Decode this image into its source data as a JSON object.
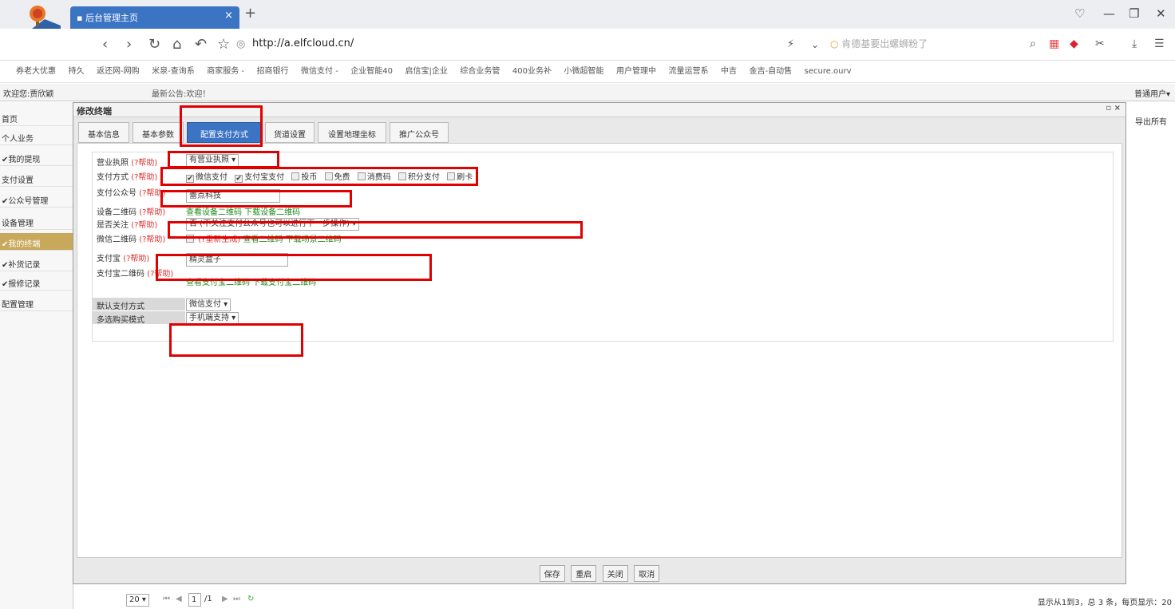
{
  "browser": {
    "tab_title": "后台管理主页",
    "tab_close": "×",
    "new_tab": "+",
    "url": "http://a.elfcloud.cn/",
    "search_placeholder": "肯德基要出螺蛳粉了"
  },
  "bookmarks": [
    "券老大优惠",
    "持久",
    "返还网-网购",
    "米泉-查询系",
    "商家服务 -",
    "招商银行",
    "微信支付 -",
    "企业智能40",
    "启信宝|企业",
    "综合业务管",
    "400业务补",
    "小微超智能",
    "用户管理中",
    "流量运营系",
    "中吉",
    "金吉-自动售",
    "secure.ourv"
  ],
  "appbar": {
    "welcome": "欢迎您:贾欣颖",
    "notice": "最新公告:欢迎！",
    "user_menu": "普通用户▾"
  },
  "sidebar": {
    "items": [
      {
        "label": "首页"
      },
      {
        "label": "个人业务"
      },
      {
        "label": "✔我的提现"
      },
      {
        "label": "支付设置"
      },
      {
        "label": "✔公众号管理"
      },
      {
        "label": "设备管理"
      },
      {
        "label": "✔我的终端"
      },
      {
        "label": "✔补货记录"
      },
      {
        "label": "✔报修记录"
      },
      {
        "label": "配置管理"
      }
    ]
  },
  "right_button": "导出所有",
  "dialog": {
    "title": "修改终端",
    "controls": "▫ ×",
    "tabs": [
      {
        "label": "基本信息"
      },
      {
        "label": "基本参数"
      },
      {
        "label": "配置支付方式"
      },
      {
        "label": "货道设置"
      },
      {
        "label": "设置地理坐标"
      },
      {
        "label": "推广公众号"
      }
    ],
    "active_tab": "配置支付方式",
    "form": {
      "license_label": "营业执照",
      "license_help": "(?帮助)",
      "license_value": "有营业执照 ▾",
      "paymethod_label": "支付方式",
      "paymethod_help": "(?帮助)",
      "paymethods": [
        {
          "label": "微信支付",
          "checked": true
        },
        {
          "label": "支付宝支付",
          "checked": true
        },
        {
          "label": "投币",
          "checked": false
        },
        {
          "label": "免费",
          "checked": false
        },
        {
          "label": "消费码",
          "checked": false
        },
        {
          "label": "积分支付",
          "checked": false
        },
        {
          "label": "刷卡",
          "checked": false
        }
      ],
      "pubacct_label": "支付公众号",
      "pubacct_help": "(?帮助)",
      "pubacct_value": "蕾点科技",
      "devqr_label": "设备二维码",
      "devqr_help": "(?帮助)",
      "devqr_links": "查看设备二维码 下载设备二维码",
      "follow_label": "是否关注",
      "follow_help": "(?帮助)",
      "follow_value": "否 (不关注支付公众号也可以进行下一步操作) ▾",
      "wxqr_label": "微信二维码",
      "wxqr_help": "(?帮助)",
      "wxqr_regen": "(?重新生成)",
      "wxqr_links": "查看二维码 下载场景二维码",
      "alipay_label": "支付宝",
      "alipay_help": "(?帮助)",
      "alipay_value": "精灵盒子",
      "alipayqr_label": "支付宝二维码",
      "alipayqr_help": "(?帮助)",
      "alipayqr_links": "查看支付宝二维码 下载支付宝二维码",
      "default_label": "默认支付方式",
      "default_value": "微信支付 ▾",
      "multibuy_label": "多选购买模式",
      "multibuy_value": "手机端支持 ▾"
    },
    "buttons": [
      "保存",
      "重启",
      "关闭",
      "取消"
    ]
  },
  "pager": {
    "page_size": "20 ▾",
    "page": "1",
    "total_pages": "/1",
    "status": "显示从1到3，总 3 条，每页显示：20"
  }
}
